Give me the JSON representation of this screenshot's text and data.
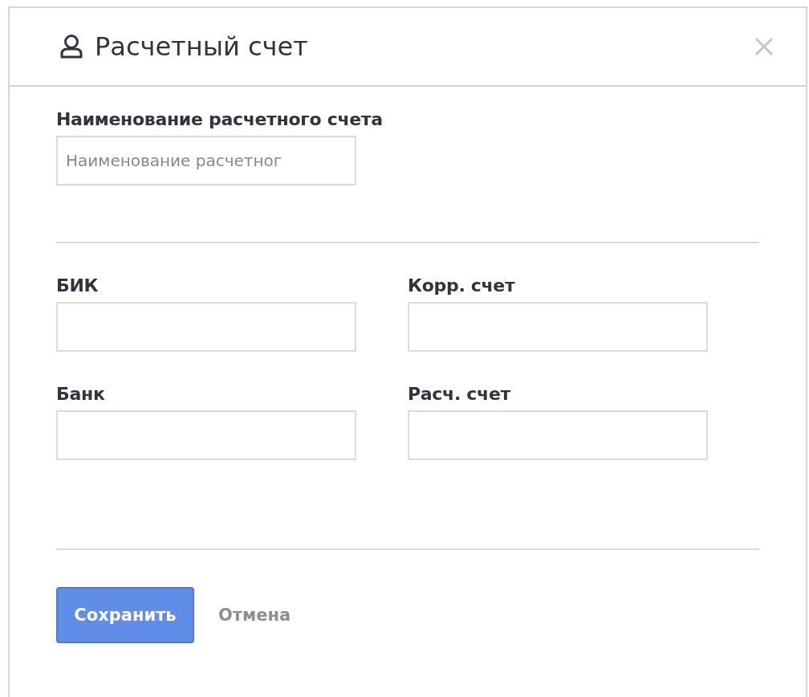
{
  "dialog": {
    "title": "Расчетный счет"
  },
  "name_field": {
    "label": "Наименование расчетного счета",
    "placeholder": "Наименование расчетног"
  },
  "fields": [
    {
      "label": "БИК"
    },
    {
      "label": "Корр. счет"
    },
    {
      "label": "Банк"
    },
    {
      "label": "Расч. счет"
    }
  ],
  "buttons": [
    {
      "label": "Сохранить",
      "kind": "primary"
    },
    {
      "label": "Отмена",
      "kind": "link"
    }
  ]
}
